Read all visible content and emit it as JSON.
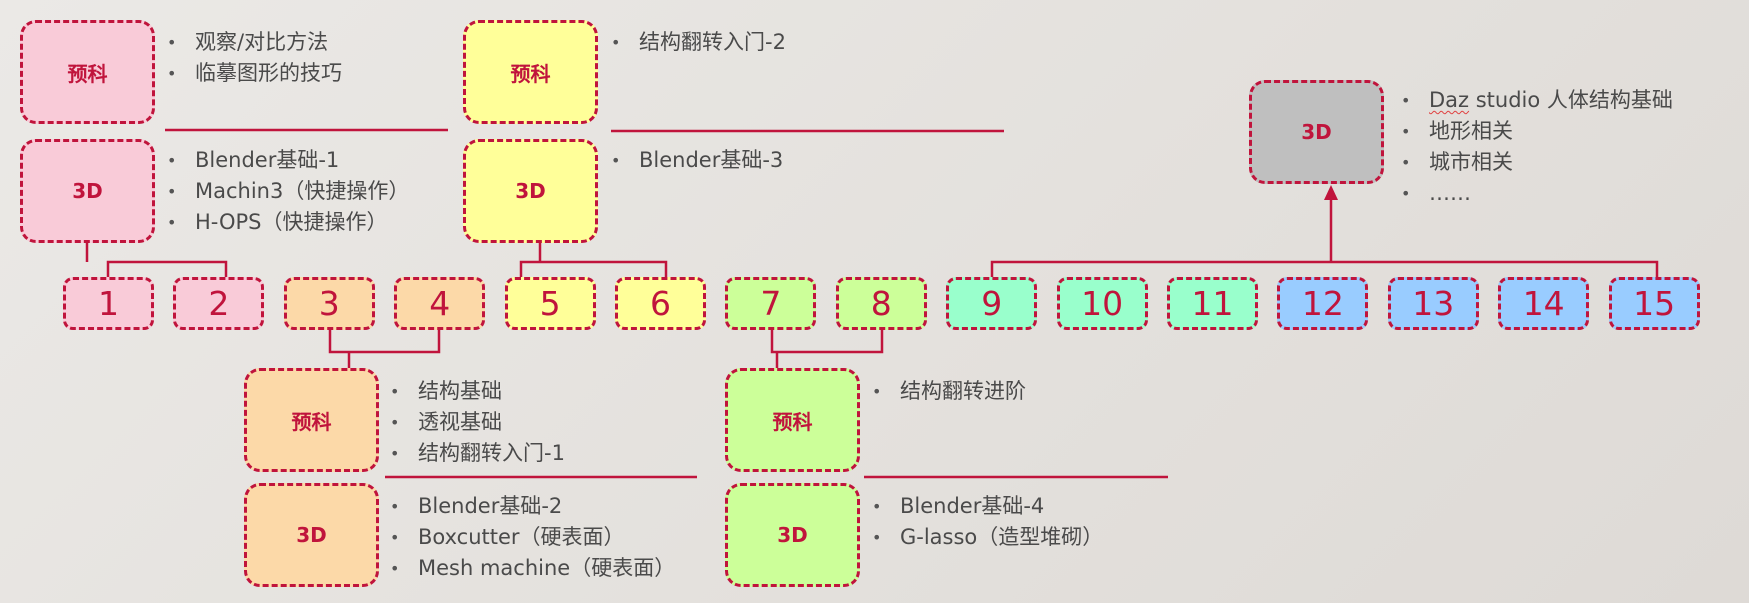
{
  "colors": {
    "border": "#c0143c",
    "pink": "#f9cbd8",
    "orange": "#fcd9a8",
    "yellow": "#ffff99",
    "green": "#ccff99",
    "teal": "#99ffcc",
    "blue": "#99ccff",
    "gray": "#bfbfbf"
  },
  "numbers": [
    "1",
    "2",
    "3",
    "4",
    "5",
    "6",
    "7",
    "8",
    "9",
    "10",
    "11",
    "12",
    "13",
    "14",
    "15"
  ],
  "groups": [
    {
      "pre_label": "预科",
      "pre_items": [
        "观察/对比方法",
        "临摹图形的技巧"
      ],
      "d3_label": "3D",
      "d3_items": [
        "Blender基础-1",
        "Machin3（快捷操作）",
        "H-OPS（快捷操作）"
      ]
    },
    {
      "pre_label": "预科",
      "pre_items": [
        "结构基础",
        "透视基础",
        "结构翻转入门-1"
      ],
      "d3_label": "3D",
      "d3_items": [
        "Blender基础-2",
        "Boxcutter（硬表面）",
        "Mesh machine（硬表面）"
      ]
    },
    {
      "pre_label": "预科",
      "pre_items": [
        "结构翻转入门-2"
      ],
      "d3_label": "3D",
      "d3_items": [
        "Blender基础-3"
      ]
    },
    {
      "pre_label": "预科",
      "pre_items": [
        "结构翻转进阶"
      ],
      "d3_label": "3D",
      "d3_items": [
        "Blender基础-4",
        "G-lasso（造型堆砌）"
      ]
    },
    {
      "d3_label": "3D",
      "d3_items": [
        "Daz studio 人体结构基础",
        "地形相关",
        "城市相关",
        "……"
      ]
    }
  ]
}
